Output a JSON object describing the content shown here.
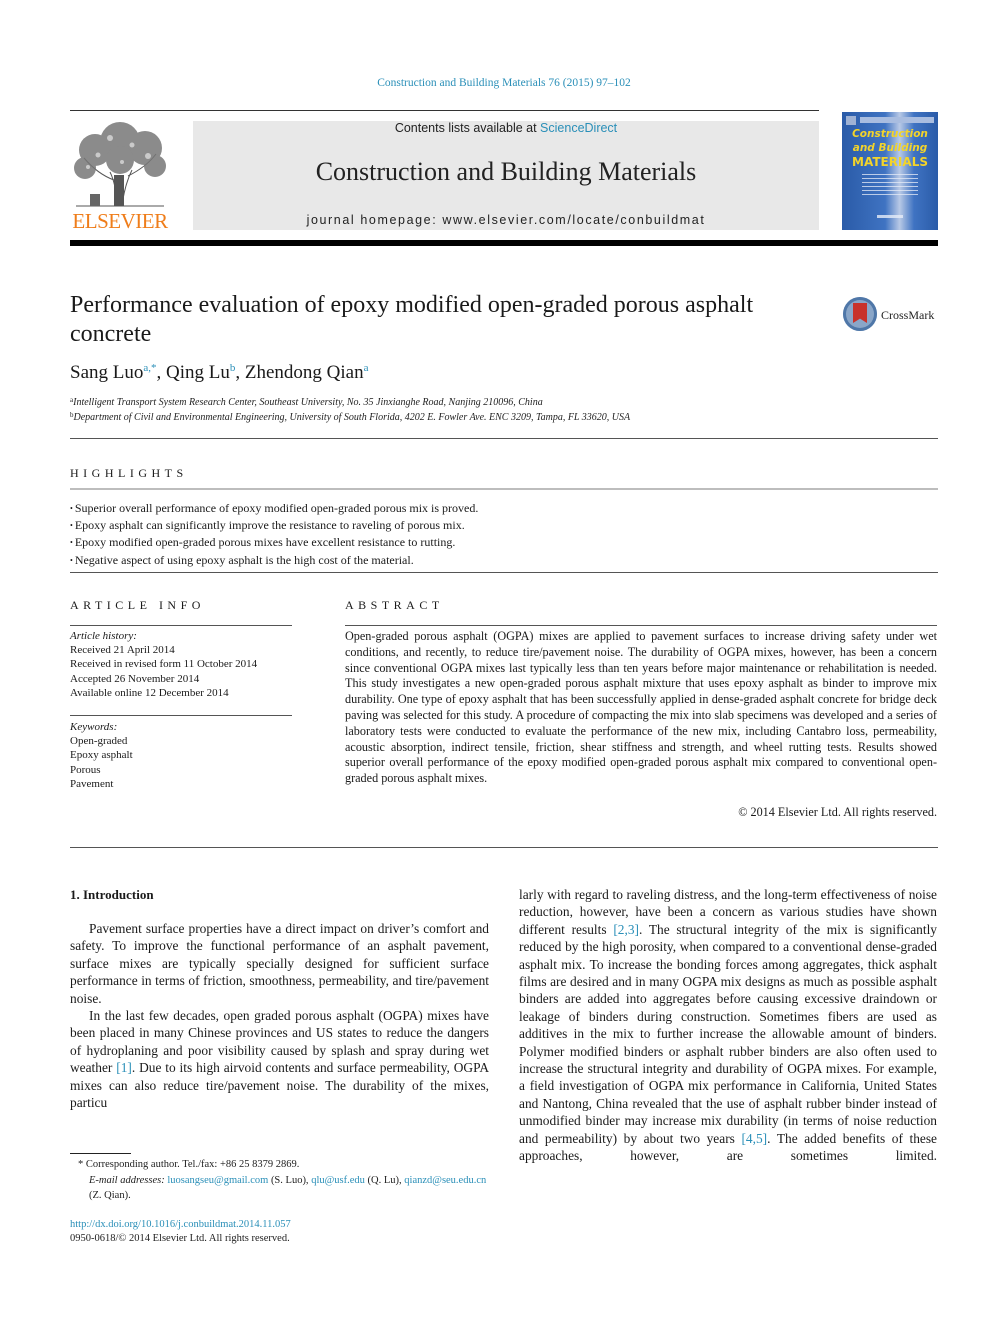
{
  "header": {
    "journal_ref": "Construction and Building Materials 76 (2015) 97–102",
    "contents_prefix": "Contents lists available at ",
    "contents_link": "ScienceDirect",
    "journal_title": "Construction and Building Materials",
    "homepage": "journal homepage: www.elsevier.com/locate/conbuildmat",
    "publisher_logo_text": "ELSEVIER",
    "cover": {
      "title_line1": "Construction",
      "title_line2": "and Building",
      "title_line3": "MATERIALS",
      "title_color": "#f3d42a",
      "background_color": "#2a5ba8"
    },
    "publisher_color": "#ef7d1a",
    "link_color": "#2a8fb8"
  },
  "article": {
    "title": "Performance evaluation of epoxy modified open-graded porous asphalt concrete",
    "crossmark_label": "CrossMark",
    "authors": [
      {
        "name": "Sang Luo",
        "sup": "a,*"
      },
      {
        "name": "Qing Lu",
        "sup": "b"
      },
      {
        "name": "Zhendong Qian",
        "sup": "a"
      }
    ],
    "affiliations": [
      {
        "key": "a",
        "text": "Intelligent Transport System Research Center, Southeast University, No. 35 Jinxianghe Road, Nanjing 210096, China"
      },
      {
        "key": "b",
        "text": "Department of Civil and Environmental Engineering, University of South Florida, 4202 E. Fowler Ave. ENC 3209, Tampa, FL 33620, USA"
      }
    ]
  },
  "highlights": {
    "heading": "HIGHLIGHTS",
    "items": [
      "Superior overall performance of epoxy modified open-graded porous mix is proved.",
      "Epoxy asphalt can significantly improve the resistance to raveling of porous mix.",
      "Epoxy modified open-graded porous mixes have excellent resistance to rutting.",
      "Negative aspect of using epoxy asphalt is the high cost of the material."
    ]
  },
  "article_info": {
    "heading": "ARTICLE INFO",
    "history_label": "Article history:",
    "history": [
      "Received 21 April 2014",
      "Received in revised form 11 October 2014",
      "Accepted 26 November 2014",
      "Available online 12 December 2014"
    ],
    "keywords_label": "Keywords:",
    "keywords": [
      "Open-graded",
      "Epoxy asphalt",
      "Porous",
      "Pavement"
    ]
  },
  "abstract": {
    "heading": "ABSTRACT",
    "text": "Open-graded porous asphalt (OGPA) mixes are applied to pavement surfaces to increase driving safety under wet conditions, and recently, to reduce tire/pavement noise. The durability of OGPA mixes, how­ever, has been a concern since conventional OGPA mixes last typically less than ten years before major maintenance or rehabilitation is needed. This study investigates a new open-graded porous asphalt mix­ture that uses epoxy asphalt as binder to improve mix durability. One type of epoxy asphalt that has been successfully applied in dense-graded asphalt concrete for bridge deck paving was selected for this study. A procedure of compacting the mix into slab specimens was developed and a series of laboratory tests were conducted to evaluate the performance of the new mix, including Cantabro loss, permeability, acoustic absorption, indirect tensile, friction, shear stiffness and strength, and wheel rutting tests. Results showed superior overall performance of the epoxy modified open-graded porous asphalt mix compared to conventional open-graded porous asphalt mixes.",
    "copyright": "© 2014 Elsevier Ltd. All rights reserved."
  },
  "body": {
    "section_heading": "1. Introduction",
    "left_p1": "Pavement surface properties have a direct impact on driver’s comfort and safety. To improve the functional performance of an asphalt pavement, surface mixes are typically specially designed for sufficient surface performance in terms of friction, smoothness, permeability, and tire/pavement noise.",
    "left_p2_a": "In the last few decades, open graded porous asphalt (OGPA) mixes have been placed in many Chinese provinces and US states to reduce the dangers of hydroplaning and poor visibility caused by splash and spray during wet weather ",
    "left_p2_ref": "[1]",
    "left_p2_b": ". Due to its high air­void contents and surface permeability, OGPA mixes can also reduce tire/pavement noise. The durability of the mixes, particu­",
    "right_p_a": "larly with regard to raveling distress, and the long-term effective­ness of noise reduction, however, have been a concern as various studies have shown different results ",
    "right_p_ref1": "[2,3]",
    "right_p_b": ". The structural integrity of the mix is significantly reduced by the high porosity, when com­pared to a conventional dense-graded asphalt mix. To increase the bonding forces among aggregates, thick asphalt films are desired and in many OGPA mix designs as much as possible asphalt bind­ers are added into aggregates before causing excessive draindown or leakage of binders during construction. Sometimes fibers are used as additives in the mix to further increase the allowable amount of binders. Polymer modified binders or asphalt rubber binders are also often used to increase the structural integrity and durability of OGPA mixes. For example, a field investigation of OGPA mix performance in California, United States and Nantong, China revealed that the use of asphalt rubber binder instead of unmodified binder may increase mix durability (in terms of noise reduction and permeability) by about two years ",
    "right_p_ref2": "[4,5]",
    "right_p_c": ". The added benefits of these approaches, however, are sometimes limited."
  },
  "footnotes": {
    "corresponding": "* Corresponding author. Tel./fax: +86 25 8379 2869.",
    "email_label": "E-mail addresses: ",
    "emails": [
      {
        "address": "luosangseu@gmail.com",
        "who": " (S. Luo), "
      },
      {
        "address": "qlu@usf.edu",
        "who": " (Q. Lu), "
      },
      {
        "address": "qianzd@seu.edu.cn",
        "who": " (Z. Qian)."
      }
    ],
    "doi": "http://dx.doi.org/10.1016/j.conbuildmat.2014.11.057",
    "issn": "0950-0618/© 2014 Elsevier Ltd. All rights reserved."
  }
}
